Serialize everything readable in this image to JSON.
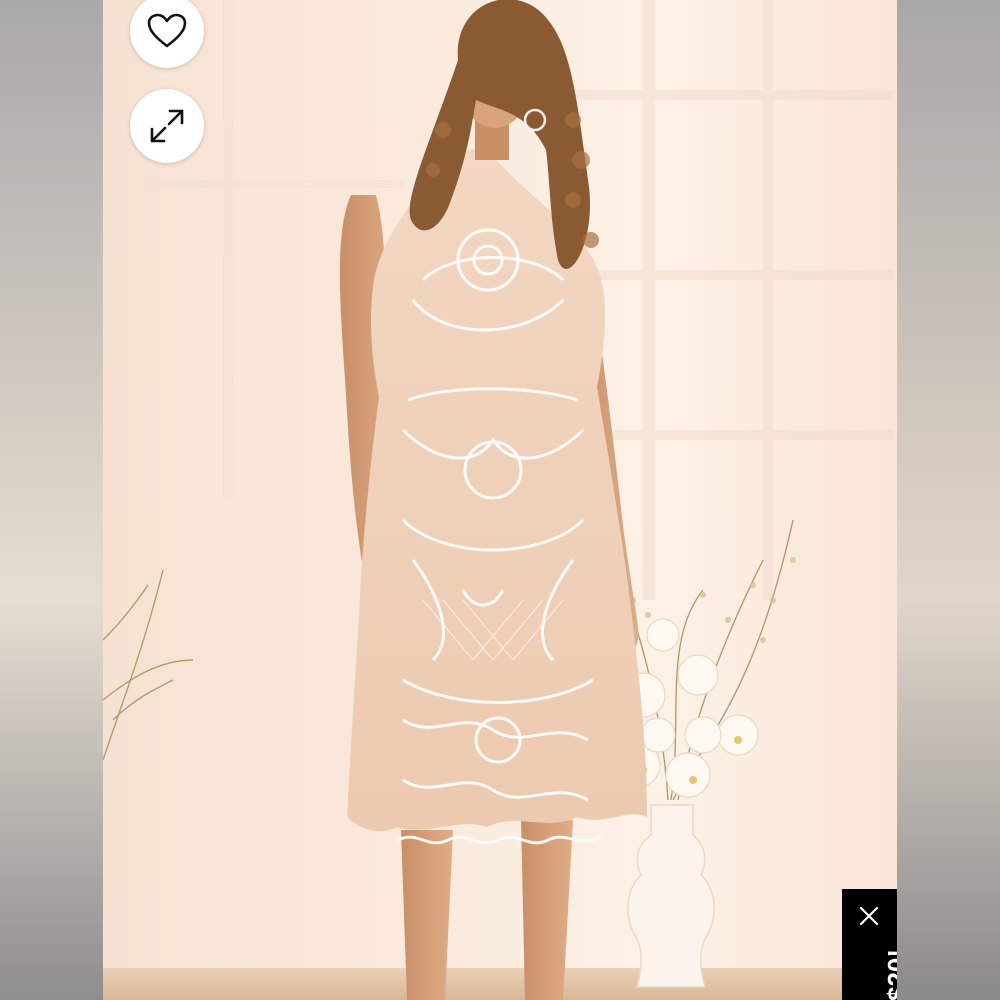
{
  "viewer": {
    "favorite_icon": "heart-outline-icon",
    "expand_icon": "expand-arrows-icon",
    "image_subject": "product-photo"
  },
  "promo": {
    "text": "$20!",
    "close_icon": "close-icon",
    "background": "#000000",
    "color": "#ffffff"
  }
}
